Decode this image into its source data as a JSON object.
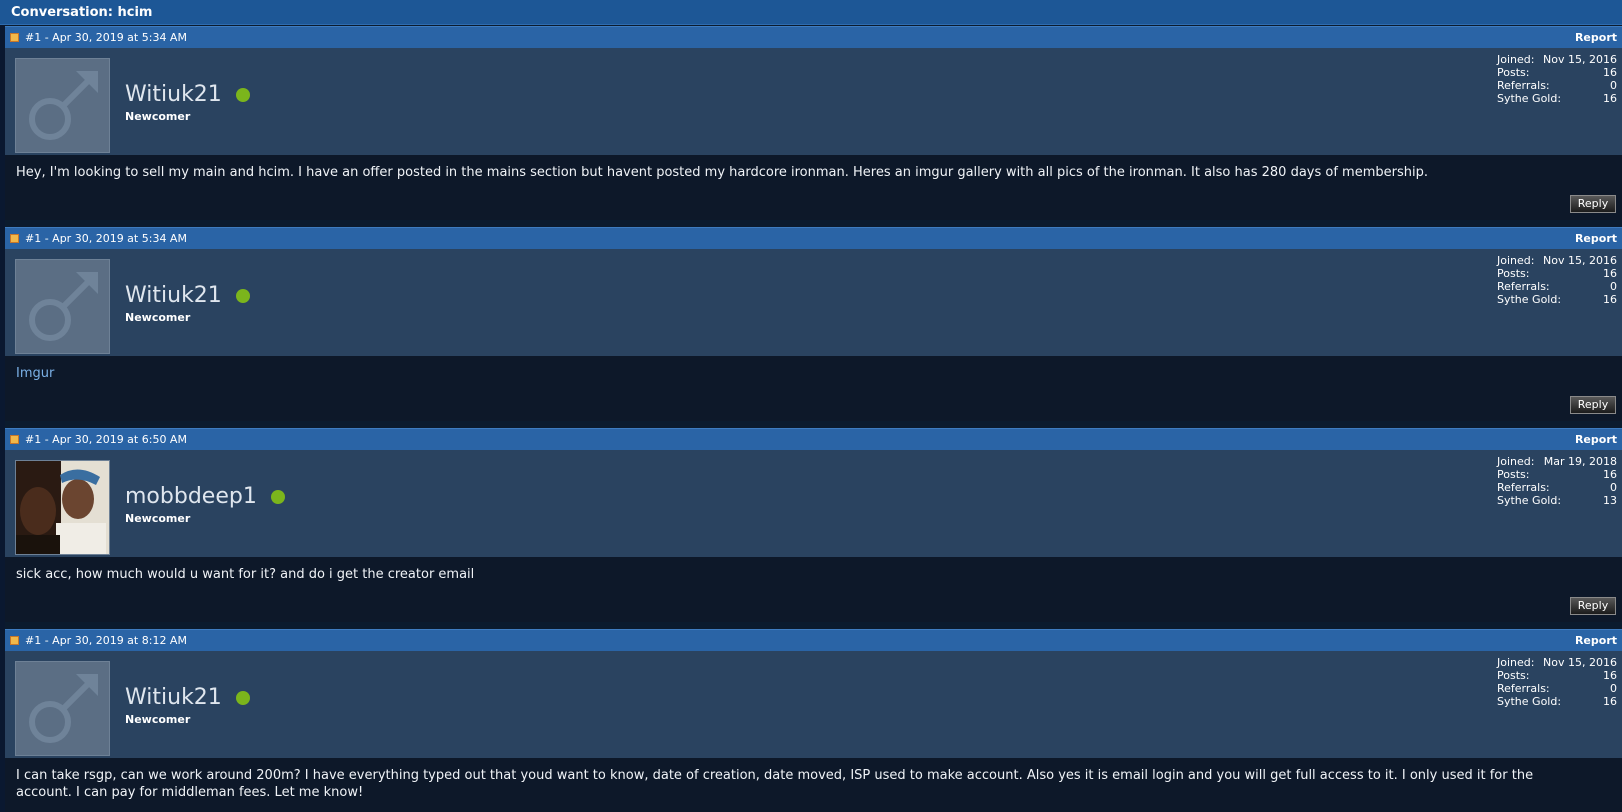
{
  "conversation": {
    "title": "Conversation: hcim"
  },
  "posts": [
    {
      "meta": "#1 - Apr 30, 2019 at 5:34 AM",
      "report_label": "Report",
      "username": "Witiuk21",
      "user_title": "Newcomer",
      "avatar": "default-male-avatar",
      "stats": {
        "joined_label": "Joined:",
        "joined": "Nov 15, 2016",
        "posts_label": "Posts:",
        "posts": "16",
        "referrals_label": "Referrals:",
        "referrals": "0",
        "gold_label": "Sythe Gold:",
        "gold": "16"
      },
      "message": "Hey, I'm looking to sell my main and hcim. I have an offer posted in the mains section but havent posted my hardcore ironman. Heres an imgur gallery with all pics of the ironman. It also has 280 days of membership.",
      "reply_label": "Reply"
    },
    {
      "meta": "#1 - Apr 30, 2019 at 5:34 AM",
      "report_label": "Report",
      "username": "Witiuk21",
      "user_title": "Newcomer",
      "avatar": "default-male-avatar",
      "stats": {
        "joined_label": "Joined:",
        "joined": "Nov 15, 2016",
        "posts_label": "Posts:",
        "posts": "16",
        "referrals_label": "Referrals:",
        "referrals": "0",
        "gold_label": "Sythe Gold:",
        "gold": "16"
      },
      "message": "Imgur",
      "reply_label": "Reply"
    },
    {
      "meta": "#1 - Apr 30, 2019 at 6:50 AM",
      "report_label": "Report",
      "username": "mobbdeep1",
      "user_title": "Newcomer",
      "avatar": "photo-avatar",
      "stats": {
        "joined_label": "Joined:",
        "joined": "Mar 19, 2018",
        "posts_label": "Posts:",
        "posts": "16",
        "referrals_label": "Referrals:",
        "referrals": "0",
        "gold_label": "Sythe Gold:",
        "gold": "13"
      },
      "message": "sick acc, how much would u want for it? and do i get the creator email",
      "reply_label": "Reply"
    },
    {
      "meta": "#1 - Apr 30, 2019 at 8:12 AM",
      "report_label": "Report",
      "username": "Witiuk21",
      "user_title": "Newcomer",
      "avatar": "default-male-avatar",
      "stats": {
        "joined_label": "Joined:",
        "joined": "Nov 15, 2016",
        "posts_label": "Posts:",
        "posts": "16",
        "referrals_label": "Referrals:",
        "referrals": "0",
        "gold_label": "Sythe Gold:",
        "gold": "16"
      },
      "message": "I can take rsgp, can we work around 200m? I have everything typed out that youd want to know, date of creation, date moved, ISP used to make account. Also yes it is email login and you will get full access to it. I only used it for the account. I can pay for middleman fees. Let me know!",
      "reply_label": ""
    }
  ]
}
